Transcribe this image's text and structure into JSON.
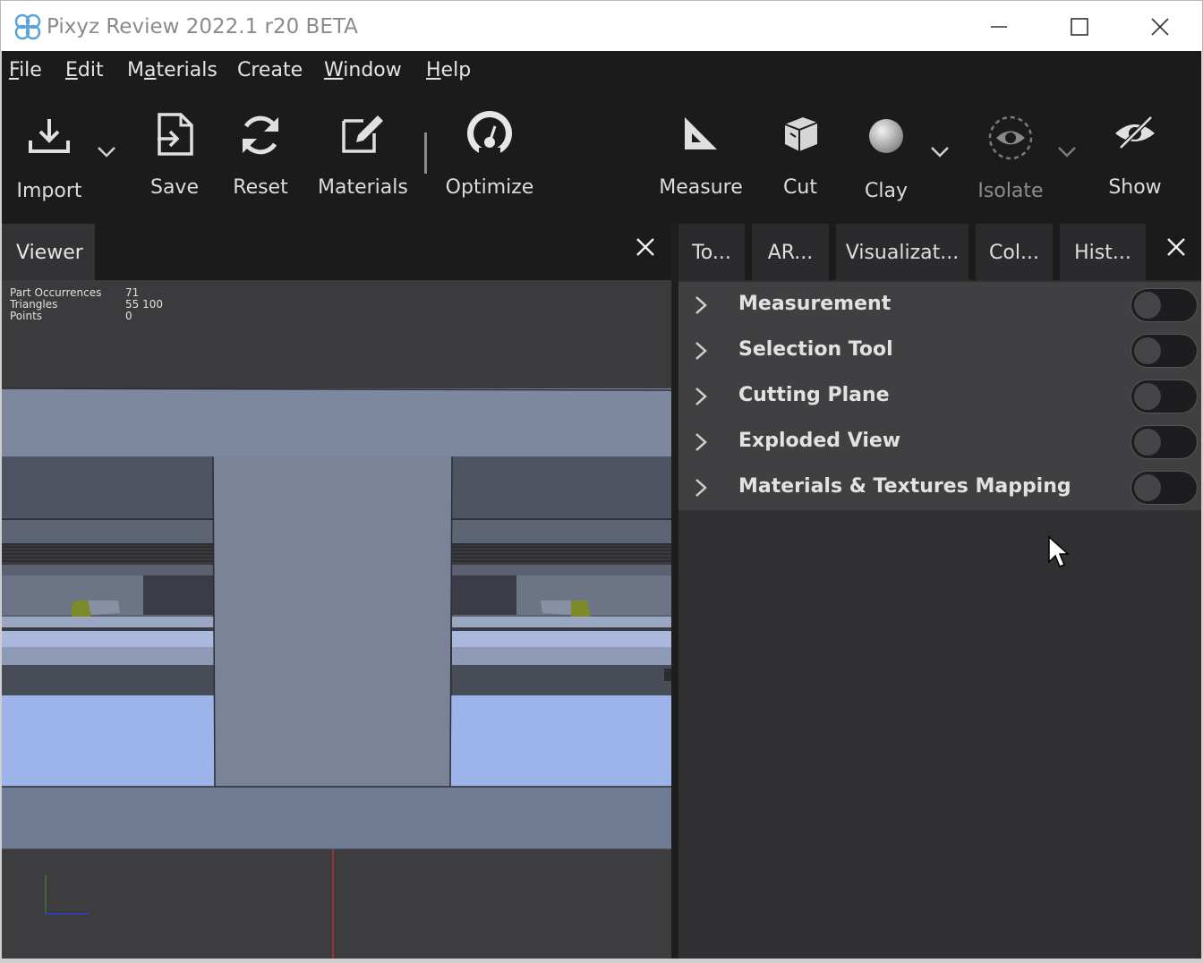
{
  "window": {
    "title": "Pixyz Review 2022.1 r20 BETA"
  },
  "menu": {
    "items": [
      {
        "label": "File",
        "mnemonic": "F",
        "rest": "ile"
      },
      {
        "label": "Edit",
        "mnemonic": "E",
        "rest": "dit"
      },
      {
        "label": "Materials",
        "pre": "M",
        "mnemonic": "a",
        "rest": "terials"
      },
      {
        "label": "Create",
        "pre": "",
        "mnemonic": "",
        "rest": "Create"
      },
      {
        "label": "Window",
        "mnemonic": "W",
        "rest": "indow"
      },
      {
        "label": "Help",
        "mnemonic": "H",
        "rest": "elp"
      }
    ]
  },
  "toolbar": {
    "import": "Import",
    "save": "Save",
    "reset": "Reset",
    "materials": "Materials",
    "optimize": "Optimize",
    "measure": "Measure",
    "cut": "Cut",
    "clay": "Clay",
    "isolate": "Isolate",
    "show": "Show"
  },
  "viewer": {
    "tab_label": "Viewer",
    "stats": [
      {
        "label": "Part Occurrences",
        "value": "71"
      },
      {
        "label": "Triangles",
        "value": "55 100"
      },
      {
        "label": "Points",
        "value": "0"
      }
    ]
  },
  "right_panel": {
    "tabs": [
      "To...",
      "AR...",
      "Visualizat...",
      "Col...",
      "Hist..."
    ],
    "tools": [
      {
        "label": "Measurement",
        "enabled": false
      },
      {
        "label": "Selection Tool",
        "enabled": false
      },
      {
        "label": "Cutting Plane",
        "enabled": false
      },
      {
        "label": "Exploded View",
        "enabled": false
      },
      {
        "label": "Materials & Textures Mapping",
        "enabled": false
      }
    ]
  },
  "colors": {
    "background": "#1b1b1b",
    "panel": "#303032",
    "row": "#404042",
    "model_blue": "#9db4ea",
    "model_gray": "#6f7a93",
    "accent_olive": "#7c8a2a"
  }
}
